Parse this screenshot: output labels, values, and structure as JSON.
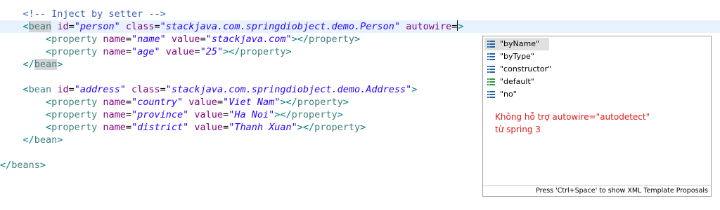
{
  "editor": {
    "comment": "<!-- Inject by setter -->",
    "bean1": {
      "open_lt": "<",
      "tag": "bean",
      "id_attr": "id",
      "id_val": "\"person\"",
      "class_attr": "class",
      "class_val": "\"stackjava.com.springdiobject.demo.Person\"",
      "autowire_attr": "autowire",
      "eq": "=",
      "properties": [
        {
          "name_val": "\"name\"",
          "value_val": "\"stackjava.com\""
        },
        {
          "name_val": "\"age\"",
          "value_val": "\"25\""
        }
      ],
      "close_tag": "bean"
    },
    "bean2": {
      "id_val": "\"address\"",
      "class_val": "\"stackjava.com.springdiobject.demo.Address\"",
      "properties": [
        {
          "name_val": "\"country\"",
          "value_val": "\"Viet Nam\""
        },
        {
          "name_val": "\"province\"",
          "value_val": "\"Ha Noi\""
        },
        {
          "name_val": "\"district\"",
          "value_val": "\"Thanh Xuan\""
        }
      ],
      "close_tag": "bean"
    },
    "tokens": {
      "lt": "<",
      "lt_slash": "</",
      "gt": ">",
      "self_close": "></",
      "eq": "=",
      "property": "property",
      "name": "name",
      "value": "value",
      "bean": "bean",
      "id": "id",
      "class": "class"
    },
    "beans_close": "beans"
  },
  "content_assist": {
    "proposals": [
      {
        "label": "\"byName\"",
        "icon": "list-icon"
      },
      {
        "label": "\"byType\"",
        "icon": "list-icon"
      },
      {
        "label": "\"constructor\"",
        "icon": "list-icon"
      },
      {
        "label": "\"default\"",
        "icon": "list-icon-green"
      },
      {
        "label": "\"no\"",
        "icon": "list-icon"
      }
    ],
    "note_line1": "Không hỗ trợ autowire=\"autodetect\"",
    "note_line2": "từ spring 3",
    "status": "Press 'Ctrl+Space' to show XML Template Proposals"
  },
  "colors": {
    "tag": "#3f7f7f",
    "attribute": "#7f007f",
    "value": "#2a00ff",
    "comment": "#3f5fbf",
    "note": "#e01b1b",
    "current_line": "#e8f2fe"
  }
}
